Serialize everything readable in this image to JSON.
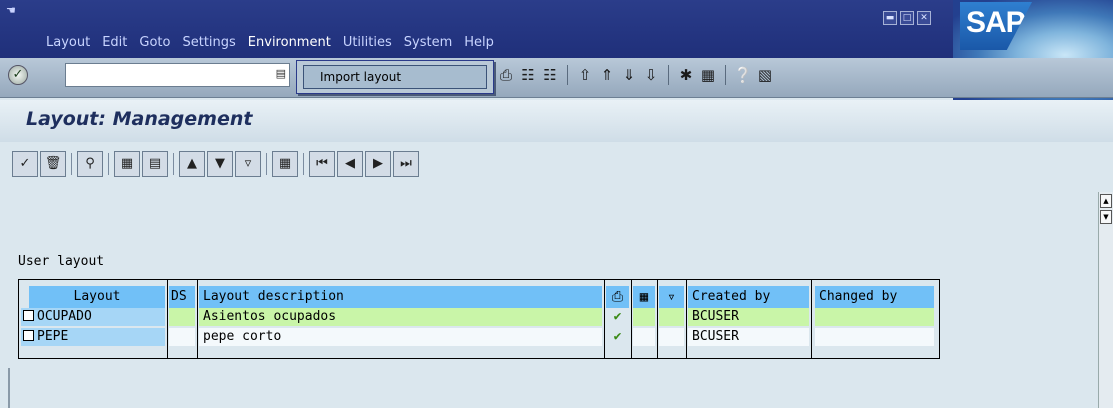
{
  "window": {
    "menu": [
      "Layout",
      "Edit",
      "Goto",
      "Settings",
      "Environment",
      "Utilities",
      "System",
      "Help"
    ],
    "logo_text": "SAP"
  },
  "toolbar": {
    "command_value": "",
    "dropdown_item": "Import layout"
  },
  "screen": {
    "title": "Layout: Management"
  },
  "content": {
    "section_label": "User layout"
  },
  "table": {
    "headers": {
      "layout": "Layout",
      "ds": "DS",
      "description": "Layout description",
      "created_by": "Created by",
      "changed_by": "Changed by"
    },
    "rows": [
      {
        "layout": "OCUPADO",
        "description": "Asientos ocupados",
        "default": "✔",
        "created_by": "BCUSER",
        "changed_by": ""
      },
      {
        "layout": "PEPE",
        "description": "pepe corto",
        "default": "✔",
        "created_by": "BCUSER",
        "changed_by": ""
      }
    ]
  },
  "colors": {
    "title_bar": "#1f2f7a",
    "header_cell": "#71c0f7",
    "row_highlight": "#c9f5a8",
    "key_cell": "#a6d6f6"
  }
}
